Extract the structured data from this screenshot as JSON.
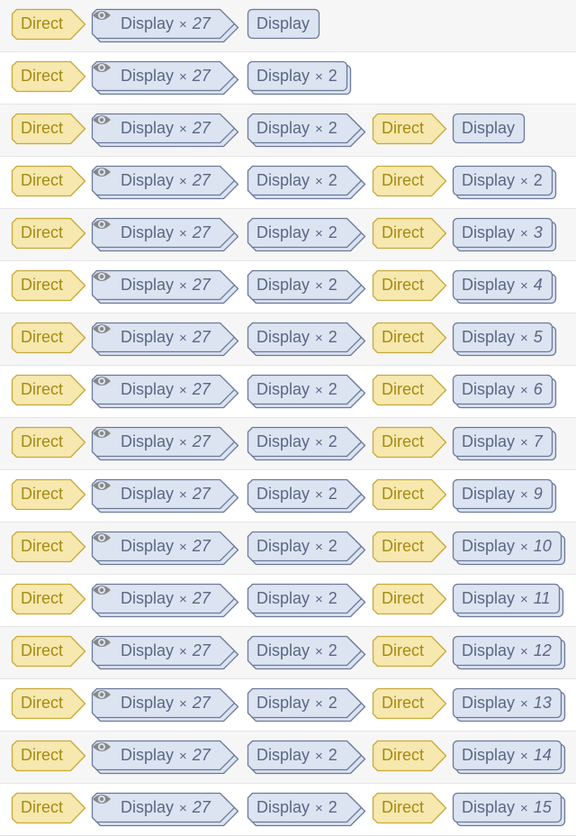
{
  "colors": {
    "direct_fill": "#f6e8ae",
    "direct_border": "#c8a93a",
    "direct_text": "#a68a12",
    "display_fill": "#dce4f2",
    "display_border": "#6b7a9a",
    "display_text": "#5a6784",
    "eye_icon": "#888888"
  },
  "rows": [
    {
      "c1": "Direct",
      "c2": "Display",
      "c2n": "27",
      "c3": "Display",
      "c3n": "",
      "c4": "",
      "c5": "",
      "c5n": ""
    },
    {
      "c1": "Direct",
      "c2": "Display",
      "c2n": "27",
      "c3": "Display",
      "c3n": "2",
      "c4": "",
      "c5": "",
      "c5n": ""
    },
    {
      "c1": "Direct",
      "c2": "Display",
      "c2n": "27",
      "c3": "Display",
      "c3n": "2",
      "c4": "Direct",
      "c5": "Display",
      "c5n": ""
    },
    {
      "c1": "Direct",
      "c2": "Display",
      "c2n": "27",
      "c3": "Display",
      "c3n": "2",
      "c4": "Direct",
      "c5": "Display",
      "c5n": "2"
    },
    {
      "c1": "Direct",
      "c2": "Display",
      "c2n": "27",
      "c3": "Display",
      "c3n": "2",
      "c4": "Direct",
      "c5": "Display",
      "c5n": "3"
    },
    {
      "c1": "Direct",
      "c2": "Display",
      "c2n": "27",
      "c3": "Display",
      "c3n": "2",
      "c4": "Direct",
      "c5": "Display",
      "c5n": "4"
    },
    {
      "c1": "Direct",
      "c2": "Display",
      "c2n": "27",
      "c3": "Display",
      "c3n": "2",
      "c4": "Direct",
      "c5": "Display",
      "c5n": "5"
    },
    {
      "c1": "Direct",
      "c2": "Display",
      "c2n": "27",
      "c3": "Display",
      "c3n": "2",
      "c4": "Direct",
      "c5": "Display",
      "c5n": "6"
    },
    {
      "c1": "Direct",
      "c2": "Display",
      "c2n": "27",
      "c3": "Display",
      "c3n": "2",
      "c4": "Direct",
      "c5": "Display",
      "c5n": "7"
    },
    {
      "c1": "Direct",
      "c2": "Display",
      "c2n": "27",
      "c3": "Display",
      "c3n": "2",
      "c4": "Direct",
      "c5": "Display",
      "c5n": "9"
    },
    {
      "c1": "Direct",
      "c2": "Display",
      "c2n": "27",
      "c3": "Display",
      "c3n": "2",
      "c4": "Direct",
      "c5": "Display",
      "c5n": "10"
    },
    {
      "c1": "Direct",
      "c2": "Display",
      "c2n": "27",
      "c3": "Display",
      "c3n": "2",
      "c4": "Direct",
      "c5": "Display",
      "c5n": "11"
    },
    {
      "c1": "Direct",
      "c2": "Display",
      "c2n": "27",
      "c3": "Display",
      "c3n": "2",
      "c4": "Direct",
      "c5": "Display",
      "c5n": "12"
    },
    {
      "c1": "Direct",
      "c2": "Display",
      "c2n": "27",
      "c3": "Display",
      "c3n": "2",
      "c4": "Direct",
      "c5": "Display",
      "c5n": "13"
    },
    {
      "c1": "Direct",
      "c2": "Display",
      "c2n": "27",
      "c3": "Display",
      "c3n": "2",
      "c4": "Direct",
      "c5": "Display",
      "c5n": "14"
    },
    {
      "c1": "Direct",
      "c2": "Display",
      "c2n": "27",
      "c3": "Display",
      "c3n": "2",
      "c4": "Direct",
      "c5": "Display",
      "c5n": "15"
    }
  ],
  "multiply_sign": "×",
  "icons": {
    "eye": "eye-icon"
  }
}
